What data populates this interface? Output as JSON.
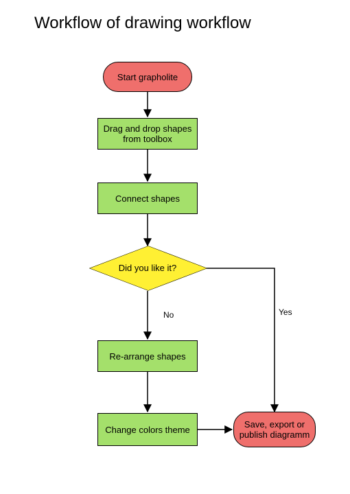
{
  "title": "Workflow of drawing workflow",
  "nodes": {
    "start": "Start grapholite",
    "drag": "Drag and drop shapes from toolbox",
    "connect": "Connect shapes",
    "decide": "Did you like it?",
    "rearr": "Re-arrange shapes",
    "colors": "Change colors theme",
    "save": "Save, export or publish diagramm"
  },
  "edges": {
    "yes": "Yes",
    "no": "No"
  },
  "colors": {
    "terminator": "#ef6f6c",
    "process": "#a4e06b",
    "decision": "#fff033"
  }
}
